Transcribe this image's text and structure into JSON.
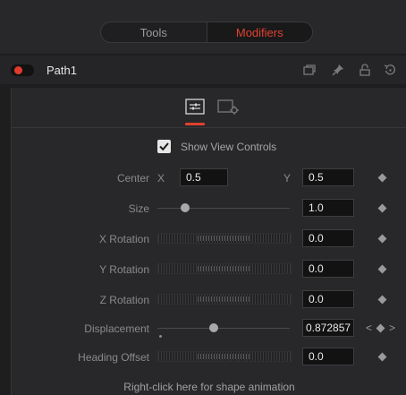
{
  "tabs": {
    "tools": "Tools",
    "modifiers": "Modifiers"
  },
  "node": {
    "name": "Path1"
  },
  "header_icons": [
    "stack-icon",
    "pin-icon",
    "lock-icon",
    "reset-icon"
  ],
  "panel_tabs": [
    "controls-tab-icon",
    "settings-tab-icon"
  ],
  "show_view_controls": {
    "label": "Show View Controls",
    "checked": true
  },
  "center": {
    "label": "Center",
    "x_label": "X",
    "x_value": "0.5",
    "y_label": "Y",
    "y_value": "0.5"
  },
  "size": {
    "label": "Size",
    "value": "1.0"
  },
  "x_rotation": {
    "label": "X Rotation",
    "value": "0.0"
  },
  "y_rotation": {
    "label": "Y Rotation",
    "value": "0.0"
  },
  "z_rotation": {
    "label": "Z Rotation",
    "value": "0.0"
  },
  "displacement": {
    "label": "Displacement",
    "value": "0.872857",
    "prev": "<",
    "next": ">"
  },
  "heading_offset": {
    "label": "Heading Offset",
    "value": "0.0"
  },
  "footer": {
    "text": "Right-click here for shape animation"
  },
  "colors": {
    "accent": "#e0402f",
    "background": "#1e1e1f",
    "panel": "#28282a"
  }
}
